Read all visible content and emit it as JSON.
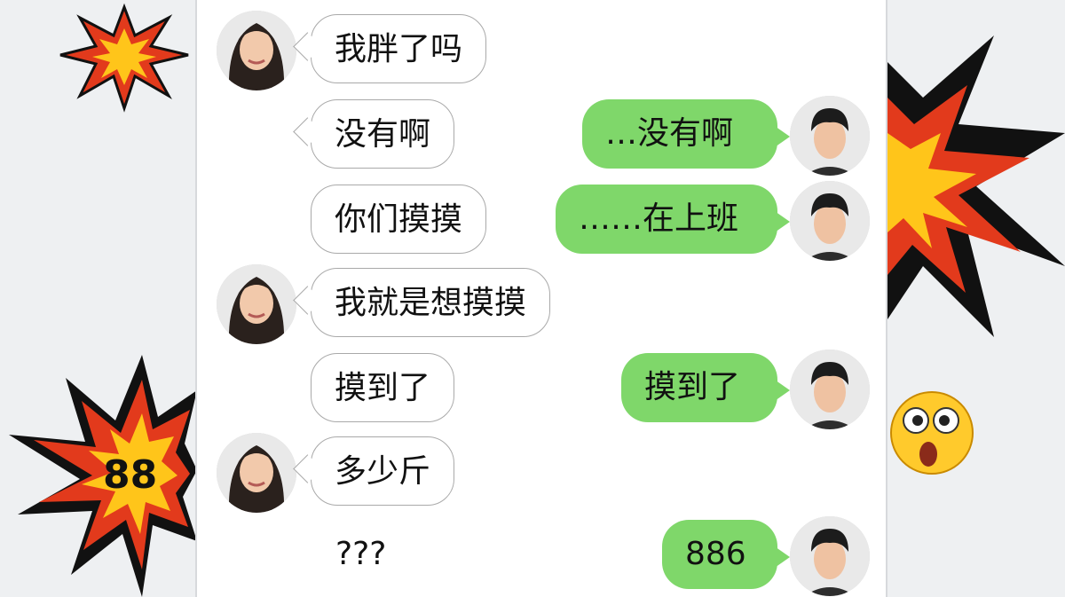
{
  "colors": {
    "outgoing_bubble": "#7fd76a",
    "incoming_bubble": "#ffffff",
    "panel": "#ffffff"
  },
  "decorations": {
    "burst_number": "88",
    "emoji": "astonished-face"
  },
  "messages": [
    {
      "side": "left",
      "avatar": true,
      "text": "我胖了吗"
    },
    {
      "side": "left",
      "avatar": false,
      "text": "没有啊"
    },
    {
      "side": "right",
      "avatar": true,
      "text": "…没有啊"
    },
    {
      "side": "left",
      "avatar": false,
      "text": "你们摸摸"
    },
    {
      "side": "right",
      "avatar": true,
      "text": "……在上班"
    },
    {
      "side": "left",
      "avatar": true,
      "text": "我就是想摸摸"
    },
    {
      "side": "left",
      "avatar": false,
      "text": "摸到了"
    },
    {
      "side": "right",
      "avatar": true,
      "text": "摸到了"
    },
    {
      "side": "left",
      "avatar": true,
      "text": "多少斤"
    },
    {
      "side": "left",
      "avatar": false,
      "text": "???"
    },
    {
      "side": "right",
      "avatar": true,
      "text": "886"
    }
  ]
}
